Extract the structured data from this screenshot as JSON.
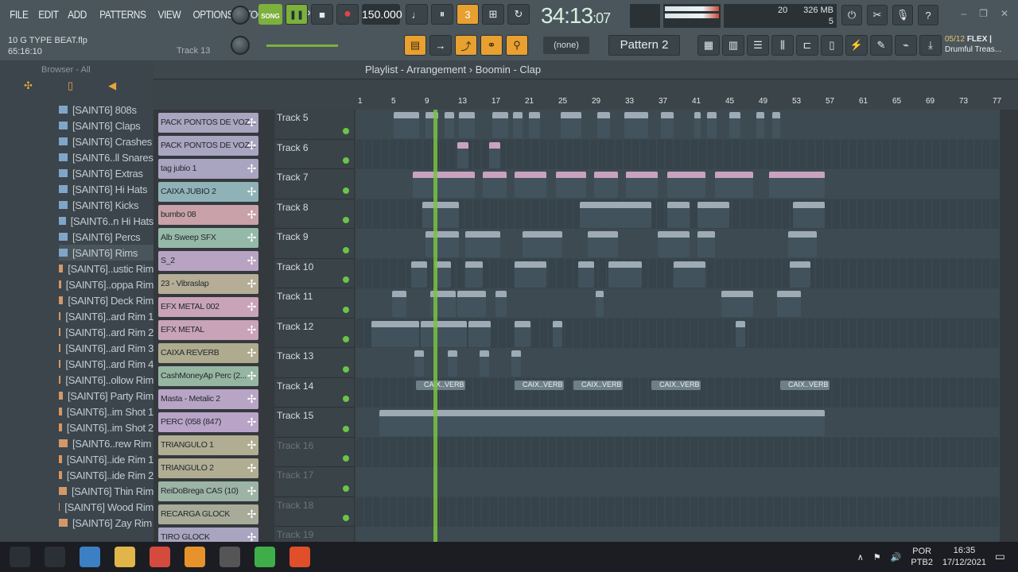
{
  "menu": [
    "FILE",
    "EDIT",
    "ADD",
    "PATTERNS",
    "VIEW",
    "OPTIONS",
    "TOOLS",
    "HELP"
  ],
  "file": {
    "name": "10 G TYPE BEAT.flp",
    "time": "65:16:10",
    "track": "Track 13"
  },
  "transport": {
    "mode": "SONG",
    "tempo": "150.000",
    "time_main": "34:13",
    "time_sub": "07"
  },
  "cpu": {
    "value": "20",
    "mem": "326 MB",
    "poly": "5"
  },
  "pattern": {
    "none": "(none)",
    "name": "Pattern 2"
  },
  "hint": {
    "counter": "05/12",
    "text": "FLEX |",
    "sub": "Drumful Treas..."
  },
  "playlist": {
    "title": "Playlist - Arrangement",
    "sep": "›",
    "sub": "Boomin - Clap"
  },
  "ruler": [
    "1",
    "5",
    "9",
    "13",
    "17",
    "21",
    "25",
    "29",
    "33",
    "37",
    "41",
    "45",
    "49",
    "53",
    "57",
    "61",
    "65",
    "69",
    "73",
    "77"
  ],
  "browser": {
    "label": "Browser - All",
    "items": [
      {
        "t": "[SAINT6] 808s",
        "k": "fold"
      },
      {
        "t": "[SAINT6] Claps",
        "k": "fold"
      },
      {
        "t": "[SAINT6] Crashes",
        "k": "fold"
      },
      {
        "t": "[SAINT6..ll Snares",
        "k": "fold"
      },
      {
        "t": "[SAINT6] Extras",
        "k": "fold"
      },
      {
        "t": "[SAINT6] Hi Hats",
        "k": "fold"
      },
      {
        "t": "[SAINT6] Kicks",
        "k": "fold"
      },
      {
        "t": "[SAINT6..n Hi Hats",
        "k": "fold"
      },
      {
        "t": "[SAINT6] Percs",
        "k": "fold"
      },
      {
        "t": "[SAINT6] Rims",
        "k": "fold sel"
      },
      {
        "t": "[SAINT6]..ustic Rim",
        "k": "file"
      },
      {
        "t": "[SAINT6]..oppa Rim",
        "k": "file"
      },
      {
        "t": "[SAINT6] Deck Rim",
        "k": "file"
      },
      {
        "t": "[SAINT6]..ard Rim 1",
        "k": "file"
      },
      {
        "t": "[SAINT6]..ard Rim 2",
        "k": "file"
      },
      {
        "t": "[SAINT6]..ard Rim 3",
        "k": "file"
      },
      {
        "t": "[SAINT6]..ard Rim 4",
        "k": "file"
      },
      {
        "t": "[SAINT6]..ollow Rim",
        "k": "file"
      },
      {
        "t": "[SAINT6] Party Rim",
        "k": "file"
      },
      {
        "t": "[SAINT6]..im Shot 1",
        "k": "file"
      },
      {
        "t": "[SAINT6]..im Shot 2",
        "k": "file"
      },
      {
        "t": "[SAINT6..rew Rim",
        "k": "file"
      },
      {
        "t": "[SAINT6]..ide Rim 1",
        "k": "file"
      },
      {
        "t": "[SAINT6]..ide Rim 2",
        "k": "file"
      },
      {
        "t": "[SAINT6] Thin Rim",
        "k": "file"
      },
      {
        "t": "[SAINT6] Wood Rim",
        "k": "file"
      },
      {
        "t": "[SAINT6] Zay Rim",
        "k": "file"
      }
    ]
  },
  "channels": [
    {
      "n": "PACK PONTOS DE VOZ...",
      "c": "#a9a4bf"
    },
    {
      "n": "PACK PONTOS DE VOZ...",
      "c": "#a9a4bf"
    },
    {
      "n": "tag jubio 1",
      "c": "#a9a4bf"
    },
    {
      "n": "CAIXA JUBIO 2",
      "c": "#8fb2b7"
    },
    {
      "n": "bumbo 08",
      "c": "#c8a2a8"
    },
    {
      "n": "Alb Sweep SFX",
      "c": "#95b9a8"
    },
    {
      "n": "S_2",
      "c": "#b9a3c2"
    },
    {
      "n": "23 - Vibraslap",
      "c": "#b6ad97"
    },
    {
      "n": "EFX METAL 002",
      "c": "#c9a3b8"
    },
    {
      "n": "EFX METAL",
      "c": "#c9a3b8"
    },
    {
      "n": "CAIXA REVERB",
      "c": "#aeab8f"
    },
    {
      "n": "CashMoneyAp Perc (2...",
      "c": "#97b6a2"
    },
    {
      "n": "Masta - Metalic 2",
      "c": "#b8a5c6"
    },
    {
      "n": "PERC (058 (847)",
      "c": "#b9a4c8"
    },
    {
      "n": "TRIANGULO 1",
      "c": "#b0ad93"
    },
    {
      "n": "TRIANGULO 2",
      "c": "#b0ad93"
    },
    {
      "n": "ReiDoBrega CAS (10)",
      "c": "#9db3a5"
    },
    {
      "n": "RECARGA GLOCK",
      "c": "#a7ab98"
    },
    {
      "n": "TIRO GLOCK",
      "c": "#a9a4bf"
    }
  ],
  "tracks": [
    "Track 5",
    "Track 6",
    "Track 7",
    "Track 8",
    "Track 9",
    "Track 10",
    "Track 11",
    "Track 12",
    "Track 13",
    "Track 14",
    "Track 15",
    "Track 16",
    "Track 17",
    "Track 18",
    "Track 19"
  ],
  "clip_label": "CAIX..VERB",
  "taskbar": {
    "lang": "POR",
    "layout": "PTB2",
    "time": "16:35",
    "date": "17/12/2021"
  }
}
